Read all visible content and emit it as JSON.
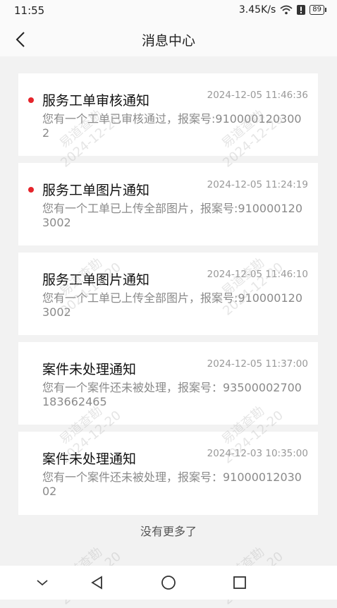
{
  "status_bar": {
    "time": "11:55",
    "net_speed": "3.45K/s",
    "battery": "89"
  },
  "header": {
    "title": "消息中心"
  },
  "messages": [
    {
      "title": "服务工单审核通知",
      "time": "2024-12-05 11:46:36",
      "body": "您有一个工单已审核通过，报案号:9100001203002",
      "unread": true
    },
    {
      "title": "服务工单图片通知",
      "time": "2024-12-05 11:24:19",
      "body": "您有一个工单已上传全部图片，报案号:9100001203002",
      "unread": true
    },
    {
      "title": "服务工单图片通知",
      "time": "2024-12-05 11:46:10",
      "body": "您有一个工单已上传全部图片，报案号:9100001203002",
      "unread": false
    },
    {
      "title": "案件未处理通知",
      "time": "2024-12-05 11:37:00",
      "body": "您有一个案件还未被处理，报案号：93500002700183662465",
      "unread": false
    },
    {
      "title": "案件未处理通知",
      "time": "2024-12-03 10:35:00",
      "body": "您有一个案件还未被处理，报案号：9100001203002",
      "unread": false
    }
  ],
  "footer": {
    "no_more": "没有更多了"
  },
  "watermark": {
    "name": "易道查勘",
    "date": "2024-12-20"
  },
  "colors": {
    "unread_dot": "#e5242b",
    "background": "#f2f2f2"
  }
}
